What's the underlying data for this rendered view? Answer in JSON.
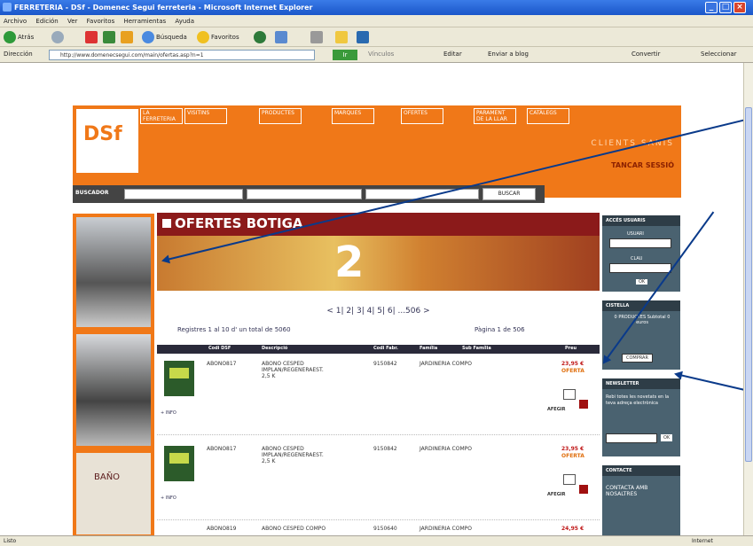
{
  "window": {
    "title": "FERRETERIA - DSf - Domenec Segui ferreteria - Microsoft Internet Explorer"
  },
  "menu": [
    "Archivo",
    "Edición",
    "Ver",
    "Favoritos",
    "Herramientas",
    "Ayuda"
  ],
  "toolbar": {
    "back": "Atrás",
    "search": "Búsqueda",
    "favorites": "Favoritos"
  },
  "address": {
    "label": "Dirección",
    "url": "http://www.domenecsegui.com/main/ofertas.asp?n=1",
    "go": "Ir",
    "vinculos": "Vínculos",
    "editar": "Editar",
    "enviar": "Enviar a blog",
    "convertir": "Convertir",
    "seleccionar": "Seleccionar"
  },
  "status": {
    "left": "Listo",
    "right": "Internet"
  },
  "site": {
    "logo": "DSf",
    "nav": [
      "LA FERRETERIA",
      "VISITINS",
      "PRODUCTES",
      "MARQUES",
      "OFERTES",
      "PARAMENT DE LA LLAR",
      "CATÀLEGS"
    ],
    "clients": "CLIENTS    SANIS",
    "logout": "TANCAR SESSIÓ",
    "search_label": "BUSCADOR",
    "search_button": "BUSCAR",
    "banner": "OFERTES BOTIGA",
    "pager": "<  1|  2|  3|  4|  5|  6|  ...506   >",
    "registres": "Registres 1 al 10 d' un total de 5060",
    "pagina": "Pàgina 1 de 506",
    "columns": [
      "Codi DSF",
      "Descripció",
      "Codi Fabr.",
      "Família",
      "Sub Família",
      "Preu"
    ],
    "products": [
      {
        "code": "ABONO817",
        "desc": "ABONO CESPED IMPLAN/REGENERAEST. 2,5 K",
        "fabr": "9150842",
        "family": "JARDINERIA COMPO",
        "price": "23,95 €",
        "offer": "OFERTA",
        "add": "AFEGIR",
        "info": "+ INFO"
      },
      {
        "code": "ABONO817",
        "desc": "ABONO CESPED IMPLAN/REGENERAEST. 2,5 K",
        "fabr": "9150842",
        "family": "JARDINERIA COMPO",
        "price": "23,95 €",
        "offer": "OFERTA",
        "add": "AFEGIR",
        "info": "+ INFO"
      },
      {
        "code": "ABONO819",
        "desc": "ABONO CESPED COMPO",
        "fabr": "9150640",
        "family": "JARDINERIA COMPO",
        "price": "24,95 €",
        "offer": "",
        "add": "",
        "info": ""
      }
    ],
    "right": {
      "access": "ACCÉS USUARIS",
      "user": "USUARI",
      "pass": "CLAU",
      "ok": "OK",
      "cistella": "CISTELLA",
      "cart_text": "0 PRODUCTES Subtotal 0 euros",
      "comprar": "COMPRAR",
      "newsletter": "NEWSLETTER",
      "news_text": "Rebi totes les novetats en la teva adreça electrònica",
      "news_ok": "OK",
      "contact": "CONTACTE",
      "contact_text": "CONTACTA AMB NOSALTRES"
    },
    "left_bath": "BAÑO"
  }
}
